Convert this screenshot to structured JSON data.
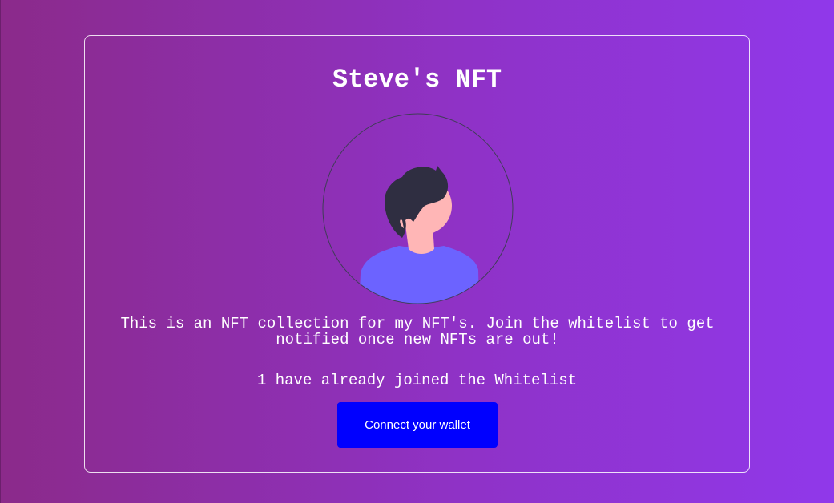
{
  "page": {
    "title": "Steve's NFT",
    "description": "This is an NFT collection for my NFT's. Join the whitelist to get\nnotified once new NFTs are out!",
    "whitelist_count_text": "1 have already joined the Whitelist"
  },
  "avatar": {
    "icon": "person-avatar-icon",
    "colors": {
      "hair": "#2f2e41",
      "skin": "#ffb6b6",
      "shirt": "#6c63ff",
      "ring": "#3f3d56"
    }
  },
  "wallet": {
    "button_label": "Connect your wallet",
    "button_color": "#0000ff"
  },
  "theme": {
    "gradient_start": "#8b2a8a",
    "gradient_end": "#9038ea"
  }
}
